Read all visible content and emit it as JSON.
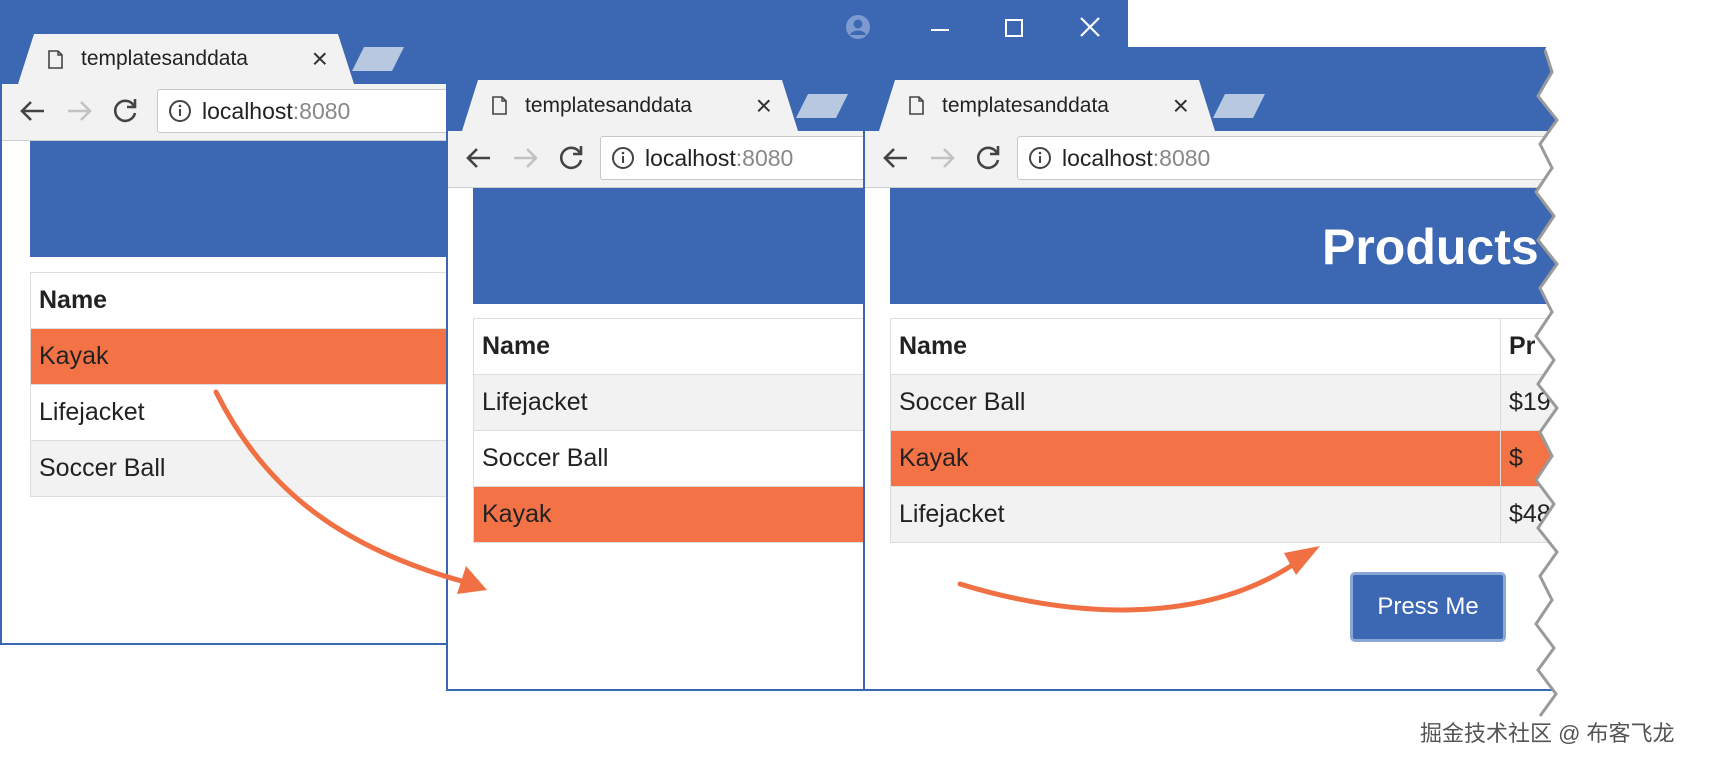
{
  "windows": [
    {
      "tab": {
        "title": "templatesanddata"
      },
      "address": {
        "host": "localhost",
        "port": ":8080"
      },
      "table": {
        "header": [
          "Name"
        ],
        "rows": [
          {
            "cells": [
              "Kayak"
            ],
            "state": "selected"
          },
          {
            "cells": [
              "Lifejacket"
            ],
            "state": "plain"
          },
          {
            "cells": [
              "Soccer Ball"
            ],
            "state": "striped"
          }
        ]
      }
    },
    {
      "tab": {
        "title": "templatesanddata"
      },
      "address": {
        "host": "localhost",
        "port": ":8080"
      },
      "table": {
        "header": [
          "Name"
        ],
        "rows": [
          {
            "cells": [
              "Lifejacket"
            ],
            "state": "striped"
          },
          {
            "cells": [
              "Soccer Ball"
            ],
            "state": "plain"
          },
          {
            "cells": [
              "Kayak"
            ],
            "state": "selected"
          }
        ]
      }
    },
    {
      "tab": {
        "title": "templatesanddata"
      },
      "address": {
        "host": "localhost",
        "port": ":8080"
      },
      "banner": {
        "title": "Products"
      },
      "table": {
        "header": [
          "Name",
          "Pr"
        ],
        "rows": [
          {
            "cells": [
              "Soccer Ball",
              "$19"
            ],
            "state": "striped"
          },
          {
            "cells": [
              "Kayak",
              "$"
            ],
            "state": "selected"
          },
          {
            "cells": [
              "Lifejacket",
              "$48"
            ],
            "state": "striped"
          }
        ]
      },
      "button": {
        "label": "Press Me"
      }
    }
  ],
  "watermark": "掘金技术社区 @ 布客飞龙",
  "colors": {
    "accent": "#3b67b3",
    "selected_row": "#f37347",
    "arrow": "#f07043"
  },
  "icons": [
    "document-icon",
    "close-icon",
    "back-arrow-icon",
    "forward-arrow-icon",
    "reload-icon",
    "info-icon",
    "profile-icon",
    "minimize-icon",
    "maximize-icon"
  ]
}
